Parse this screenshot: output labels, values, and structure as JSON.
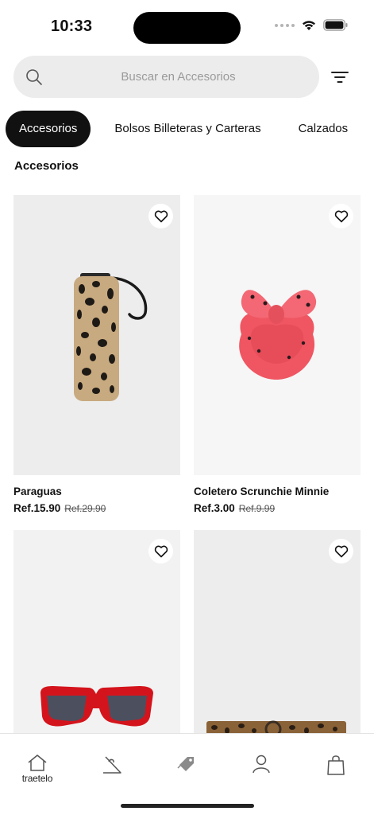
{
  "status_bar": {
    "time": "10:33"
  },
  "search": {
    "placeholder": "Buscar en Accesorios",
    "value": ""
  },
  "tabs": [
    {
      "label": "Accesorios",
      "active": true
    },
    {
      "label": "Bolsos Billeteras y Carteras",
      "active": false
    },
    {
      "label": "Calzados",
      "active": false
    }
  ],
  "section_title": "Accesorios",
  "products": [
    {
      "name": "Paraguas",
      "price": "Ref.15.90",
      "old_price": "Ref.29.90"
    },
    {
      "name": "Coletero Scrunchie Minnie",
      "price": "Ref.3.00",
      "old_price": "Ref.9.99"
    },
    {
      "name": "",
      "price": "",
      "old_price": ""
    },
    {
      "name": "",
      "price": "",
      "old_price": ""
    }
  ],
  "tab_bar": {
    "home_label": "traetelo",
    "items": [
      "home-icon",
      "hanger-icon",
      "tag-icon",
      "profile-icon",
      "shopping-bag-icon"
    ]
  },
  "colors": {
    "accent": "#111111",
    "search_bg": "#ececec",
    "scrunchie": "#f05a64",
    "sunglasses": "#d4141c"
  }
}
